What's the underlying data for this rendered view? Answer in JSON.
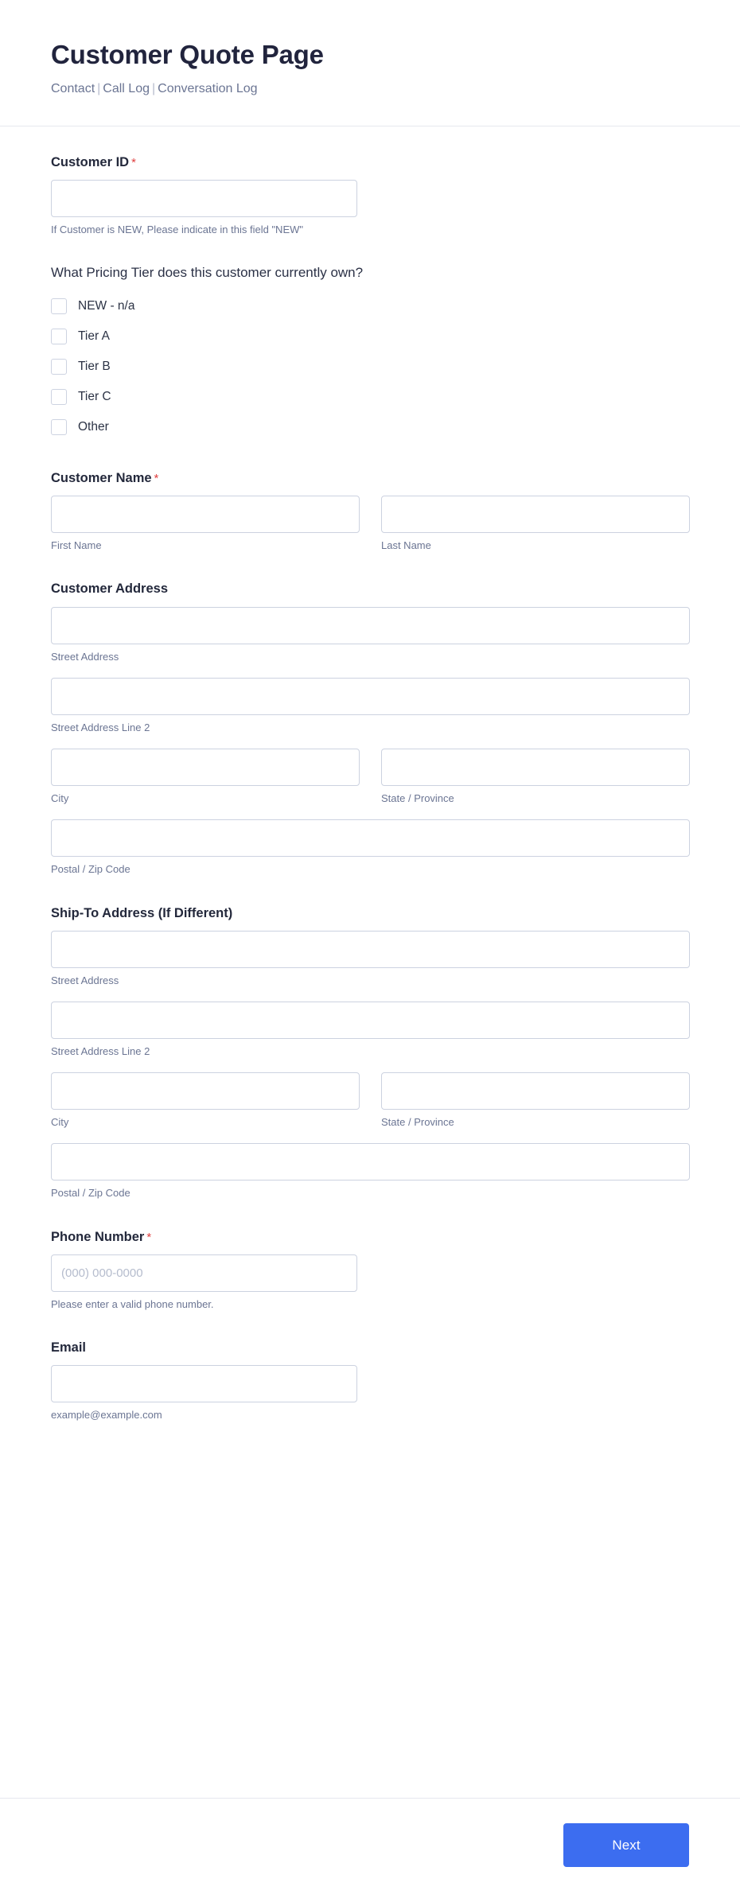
{
  "header": {
    "title": "Customer Quote Page",
    "breadcrumb": [
      {
        "label": "Contact"
      },
      {
        "label": "Call Log"
      },
      {
        "label": "Conversation Log"
      }
    ],
    "separator": "|"
  },
  "form": {
    "customer_id": {
      "label": "Customer ID",
      "required_mark": "*",
      "value": "",
      "placeholder": "",
      "hint": "If Customer is NEW, Please indicate in this field \"NEW\""
    },
    "pricing_tier": {
      "label": "What Pricing Tier does this customer currently own?",
      "options": [
        {
          "label": "NEW - n/a",
          "checked": false
        },
        {
          "label": "Tier A",
          "checked": false
        },
        {
          "label": "Tier B",
          "checked": false
        },
        {
          "label": "Tier C",
          "checked": false
        },
        {
          "label": "Other",
          "checked": false
        }
      ]
    },
    "customer_name": {
      "label": "Customer Name",
      "required_mark": "*",
      "first": {
        "value": "",
        "placeholder": "",
        "sub_label": "First Name"
      },
      "last": {
        "value": "",
        "placeholder": "",
        "sub_label": "Last Name"
      }
    },
    "customer_address": {
      "label": "Customer Address",
      "street": {
        "value": "",
        "placeholder": "",
        "sub_label": "Street Address"
      },
      "street2": {
        "value": "",
        "placeholder": "",
        "sub_label": "Street Address Line 2"
      },
      "city": {
        "value": "",
        "placeholder": "",
        "sub_label": "City"
      },
      "state": {
        "value": "",
        "placeholder": "",
        "sub_label": "State / Province"
      },
      "postal": {
        "value": "",
        "placeholder": "",
        "sub_label": "Postal / Zip Code"
      }
    },
    "ship_to_address": {
      "label": "Ship-To Address (If Different)",
      "street": {
        "value": "",
        "placeholder": "",
        "sub_label": "Street Address"
      },
      "street2": {
        "value": "",
        "placeholder": "",
        "sub_label": "Street Address Line 2"
      },
      "city": {
        "value": "",
        "placeholder": "",
        "sub_label": "City"
      },
      "state": {
        "value": "",
        "placeholder": "",
        "sub_label": "State / Province"
      },
      "postal": {
        "value": "",
        "placeholder": "",
        "sub_label": "Postal / Zip Code"
      }
    },
    "phone": {
      "label": "Phone Number",
      "required_mark": "*",
      "value": "",
      "placeholder": "(000) 000-0000",
      "hint": "Please enter a valid phone number."
    },
    "email": {
      "label": "Email",
      "value": "",
      "placeholder": "",
      "hint": "example@example.com"
    }
  },
  "footer": {
    "next_label": "Next"
  },
  "colors": {
    "accent": "#3c6df0",
    "required": "#e04141",
    "title": "#21243d",
    "muted": "#6b7593",
    "border": "#ccd2e0"
  }
}
